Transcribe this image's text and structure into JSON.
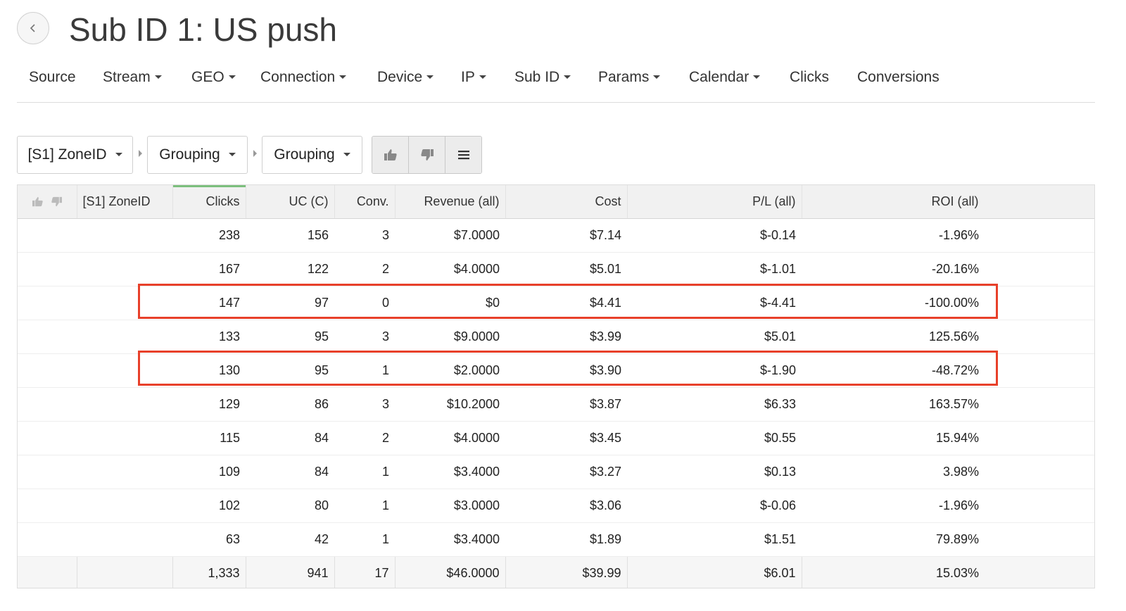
{
  "header": {
    "title": "Sub ID 1: US push",
    "back_icon": "chevron-left-icon"
  },
  "nav": {
    "items": [
      {
        "label": "Source",
        "dropdown": false
      },
      {
        "label": "Stream",
        "dropdown": true
      },
      {
        "label": "GEO",
        "dropdown": true
      },
      {
        "label": "Connection",
        "dropdown": true
      },
      {
        "label": "Device",
        "dropdown": true
      },
      {
        "label": "IP",
        "dropdown": true
      },
      {
        "label": "Sub ID",
        "dropdown": true
      },
      {
        "label": "Params",
        "dropdown": true
      },
      {
        "label": "Calendar",
        "dropdown": true
      },
      {
        "label": "Clicks",
        "dropdown": false
      },
      {
        "label": "Conversions",
        "dropdown": false
      }
    ]
  },
  "toolbar": {
    "grouping1": "[S1] ZoneID",
    "grouping2": "Grouping",
    "grouping3": "Grouping",
    "buttons": [
      "thumbs-up-icon",
      "thumbs-down-icon",
      "menu-icon"
    ]
  },
  "table": {
    "columns": {
      "zone": "[S1] ZoneID",
      "clicks": "Clicks",
      "uc": "UC (C)",
      "conv": "Conv.",
      "revenue": "Revenue (all)",
      "cost": "Cost",
      "pl": "P/L (all)",
      "roi": "ROI (all)"
    },
    "sorted_column": "Clicks",
    "rows": [
      {
        "zone": "",
        "clicks": "238",
        "uc": "156",
        "conv": "3",
        "revenue": "$7.0000",
        "cost": "$7.14",
        "pl": "$-0.14",
        "roi": "-1.96%",
        "roi_sign": "neg",
        "highlighted": false
      },
      {
        "zone": "",
        "clicks": "167",
        "uc": "122",
        "conv": "2",
        "revenue": "$4.0000",
        "cost": "$5.01",
        "pl": "$-1.01",
        "roi": "-20.16%",
        "roi_sign": "neg",
        "highlighted": false
      },
      {
        "zone": "",
        "clicks": "147",
        "uc": "97",
        "conv": "0",
        "revenue": "$0",
        "cost": "$4.41",
        "pl": "$-4.41",
        "roi": "-100.00%",
        "roi_sign": "neg",
        "highlighted": true
      },
      {
        "zone": "",
        "clicks": "133",
        "uc": "95",
        "conv": "3",
        "revenue": "$9.0000",
        "cost": "$3.99",
        "pl": "$5.01",
        "roi": "125.56%",
        "roi_sign": "pos",
        "highlighted": false
      },
      {
        "zone": "",
        "clicks": "130",
        "uc": "95",
        "conv": "1",
        "revenue": "$2.0000",
        "cost": "$3.90",
        "pl": "$-1.90",
        "roi": "-48.72%",
        "roi_sign": "neg",
        "highlighted": true
      },
      {
        "zone": "",
        "clicks": "129",
        "uc": "86",
        "conv": "3",
        "revenue": "$10.2000",
        "cost": "$3.87",
        "pl": "$6.33",
        "roi": "163.57%",
        "roi_sign": "pos",
        "highlighted": false
      },
      {
        "zone": "",
        "clicks": "115",
        "uc": "84",
        "conv": "2",
        "revenue": "$4.0000",
        "cost": "$3.45",
        "pl": "$0.55",
        "roi": "15.94%",
        "roi_sign": "pos",
        "highlighted": false
      },
      {
        "zone": "",
        "clicks": "109",
        "uc": "84",
        "conv": "1",
        "revenue": "$3.4000",
        "cost": "$3.27",
        "pl": "$0.13",
        "roi": "3.98%",
        "roi_sign": "pos",
        "highlighted": false
      },
      {
        "zone": "",
        "clicks": "102",
        "uc": "80",
        "conv": "1",
        "revenue": "$3.0000",
        "cost": "$3.06",
        "pl": "$-0.06",
        "roi": "-1.96%",
        "roi_sign": "neg",
        "highlighted": false
      },
      {
        "zone": "",
        "clicks": "63",
        "uc": "42",
        "conv": "1",
        "revenue": "$3.4000",
        "cost": "$1.89",
        "pl": "$1.51",
        "roi": "79.89%",
        "roi_sign": "pos",
        "highlighted": false
      }
    ],
    "totals": {
      "clicks": "1,333",
      "uc": "941",
      "conv": "17",
      "revenue": "$46.0000",
      "cost": "$39.99",
      "pl": "$6.01",
      "roi": "15.03%",
      "roi_sign": "pos"
    }
  },
  "colors": {
    "negative": "#e04848",
    "positive": "#4caf50",
    "highlight_border": "#e8402a",
    "sorted_indicator": "#7cbf7d"
  }
}
